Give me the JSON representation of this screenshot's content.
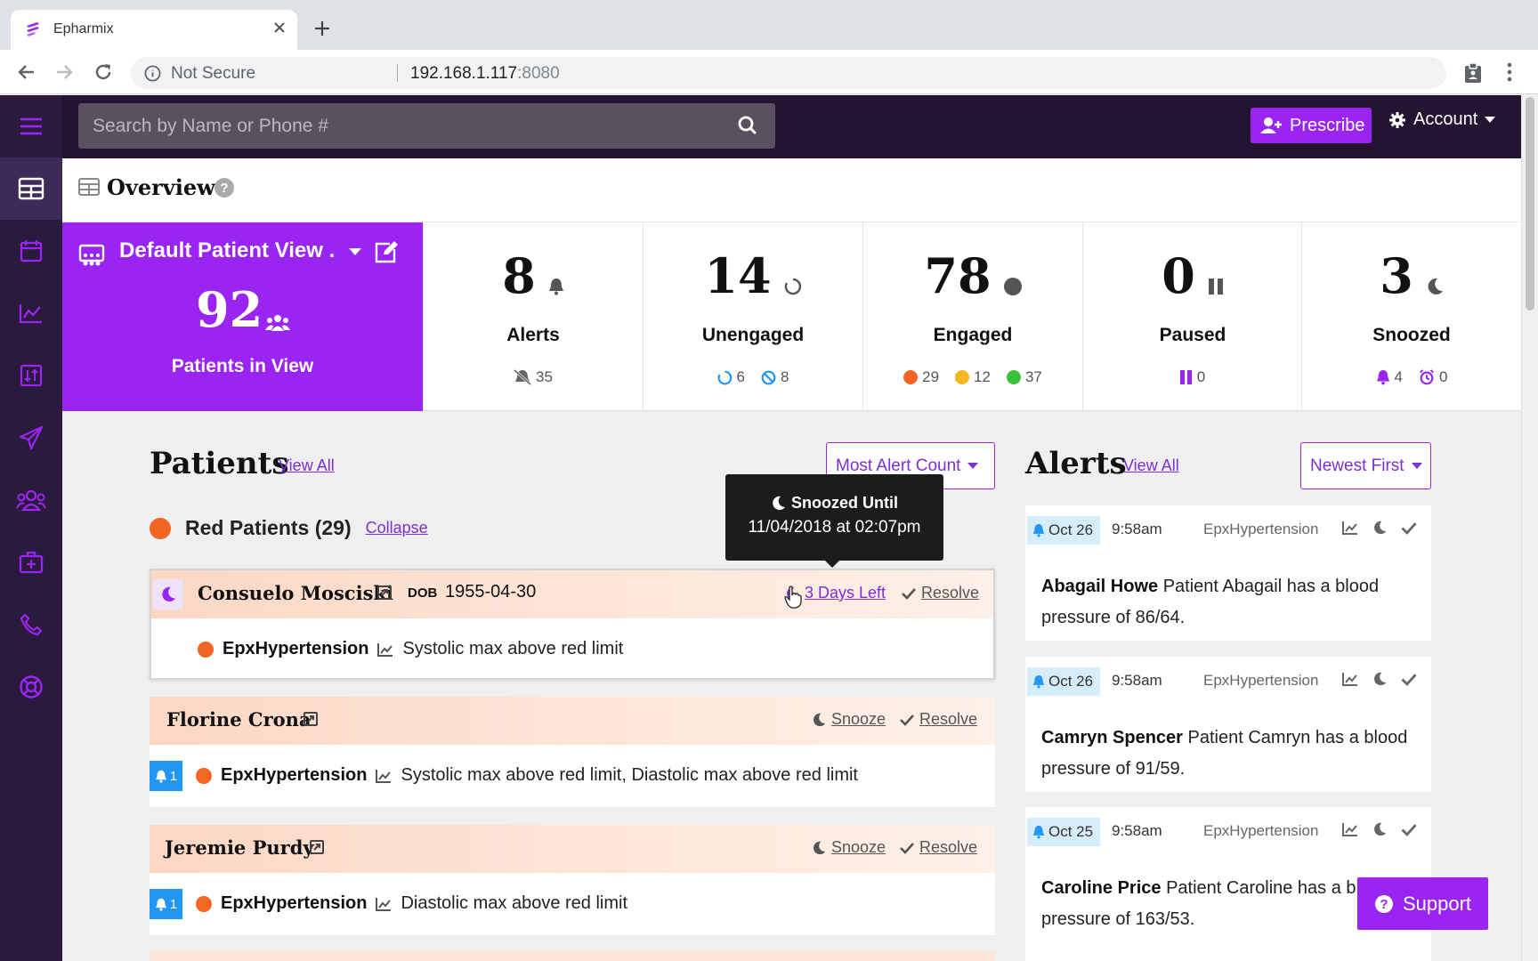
{
  "browser": {
    "tab_title": "Epharmix",
    "security_label": "Not Secure",
    "url_host": "192.168.1.117",
    "url_port": ":8080"
  },
  "header": {
    "search_placeholder": "Search by Name or Phone #",
    "prescribe_label": "Prescribe",
    "account_label": "Account"
  },
  "overview": {
    "title": "Overview",
    "view_name": "Default Patient View .",
    "patients_in_view": "92",
    "patients_in_view_label": "Patients in View",
    "stats": [
      {
        "value": "8",
        "label": "Alerts",
        "subs": [
          "35"
        ]
      },
      {
        "value": "14",
        "label": "Unengaged",
        "subs": [
          "6",
          "8"
        ]
      },
      {
        "value": "78",
        "label": "Engaged",
        "subs": [
          "29",
          "12",
          "37"
        ]
      },
      {
        "value": "0",
        "label": "Paused",
        "subs": [
          "0"
        ]
      },
      {
        "value": "3",
        "label": "Snoozed",
        "subs": [
          "4",
          "0"
        ]
      }
    ]
  },
  "patients": {
    "title": "Patients",
    "view_all": "View All",
    "sort_label": "Most Alert Count",
    "group_title": "Red Patients (29)",
    "collapse_label": "Collapse",
    "snooze_label": "Snooze",
    "resolve_label": "Resolve",
    "list": [
      {
        "name": "Consuelo Mosciski",
        "dob_label": "DOB",
        "dob": "1955-04-30",
        "days_left": "3 Days Left",
        "program": "EpxHypertension",
        "desc": "Systolic max above red limit",
        "alerts": ""
      },
      {
        "name": "Florine Crona",
        "program": "EpxHypertension",
        "desc": "Systolic max above red limit, Diastolic max above red limit",
        "alerts": "1"
      },
      {
        "name": "Jeremie Purdy",
        "program": "EpxHypertension",
        "desc": "Diastolic max above red limit",
        "alerts": "1"
      }
    ]
  },
  "tooltip": {
    "title": "Snoozed Until",
    "subtitle": "11/04/2018 at 02:07pm"
  },
  "alerts": {
    "title": "Alerts",
    "view_all": "View All",
    "sort_label": "Newest First",
    "list": [
      {
        "date": "Oct 26",
        "time": "9:58am",
        "program": "EpxHypertension",
        "name": "Abagail Howe",
        "message": " Patient Abagail has a blood pressure of 86/64."
      },
      {
        "date": "Oct 26",
        "time": "9:58am",
        "program": "EpxHypertension",
        "name": "Camryn Spencer",
        "message": " Patient Camryn has a blood pressure of 91/59."
      },
      {
        "date": "Oct 25",
        "time": "9:58am",
        "program": "EpxHypertension",
        "name": "Caroline Price",
        "message": " Patient Caroline has a blood pressure of 163/53."
      }
    ]
  },
  "support_label": "Support",
  "colors": {
    "brand": "#9a25f2",
    "header_bg": "#231432",
    "sidebar_bg": "#2a1a3d",
    "red_status": "#f26522",
    "yellow_status": "#f5b622",
    "green_status": "#3cc13b",
    "alert_blue": "#2196f3"
  },
  "icons": [
    "menu-icon",
    "overview-icon",
    "calendar-icon",
    "chart-icon",
    "transfer-icon",
    "send-icon",
    "users-icon",
    "medkit-icon",
    "phone-icon",
    "lifebuoy-icon",
    "search-icon",
    "bell-icon",
    "moon-icon",
    "check-icon",
    "pause-icon",
    "external-link-icon",
    "trend-icon"
  ]
}
